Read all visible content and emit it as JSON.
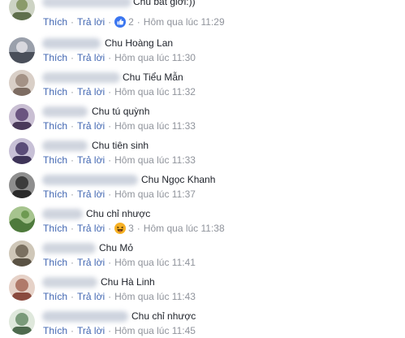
{
  "comments": [
    {
      "text": "Chu bát giới:))",
      "like_label": "Thích",
      "reply_label": "Trả lời",
      "reaction": {
        "icon": "like-icon",
        "color": "#3b76f0",
        "count": "2"
      },
      "time": "Hôm qua lúc 11:29",
      "avatar_color": "#8a9a6a"
    },
    {
      "text": "Chu Hoàng Lan",
      "like_label": "Thích",
      "reply_label": "Trả lời",
      "time": "Hôm qua lúc 11:30",
      "avatar_color": "#4a4f5a"
    },
    {
      "text": "Chu Tiểu Mẫn",
      "like_label": "Thích",
      "reply_label": "Trả lời",
      "time": "Hôm qua lúc 11:32",
      "avatar_color": "#a49286"
    },
    {
      "text": "Chu tú quỳnh",
      "like_label": "Thích",
      "reply_label": "Trả lời",
      "time": "Hôm qua lúc 11:33",
      "avatar_color": "#6a5480"
    },
    {
      "text": "Chu tiên sinh",
      "like_label": "Thích",
      "reply_label": "Trả lời",
      "time": "Hôm qua lúc 11:33",
      "avatar_color": "#5a4c78"
    },
    {
      "text": "Chu Ngọc Khanh",
      "like_label": "Thích",
      "reply_label": "Trả lời",
      "time": "Hôm qua lúc 11:37",
      "avatar_color": "#3c3c3c"
    },
    {
      "text": "Chu chỉ nhược",
      "like_label": "Thích",
      "reply_label": "Trả lời",
      "reaction": {
        "icon": "haha-icon",
        "color": "#f7b125",
        "count": "3"
      },
      "time": "Hôm qua lúc 11:38",
      "avatar_color": "#4e7a3c"
    },
    {
      "text": "Chu Mỏ",
      "like_label": "Thích",
      "reply_label": "Trả lời",
      "time": "Hôm qua lúc 11:41",
      "avatar_color": "#7a7060"
    },
    {
      "text": "Chu Hà Linh",
      "like_label": "Thích",
      "reply_label": "Trả lời",
      "time": "Hôm qua lúc 11:43",
      "avatar_color": "#b07a6a"
    },
    {
      "text": "Chu chỉ nhược",
      "like_label": "Thích",
      "reply_label": "Trả lời",
      "time": "Hôm qua lúc 11:45",
      "avatar_color": "#7a9a7a"
    }
  ],
  "colors": {
    "link": "#4267b2",
    "meta": "#90949c",
    "text": "#1d2129",
    "blur": "#c4cbd8"
  }
}
